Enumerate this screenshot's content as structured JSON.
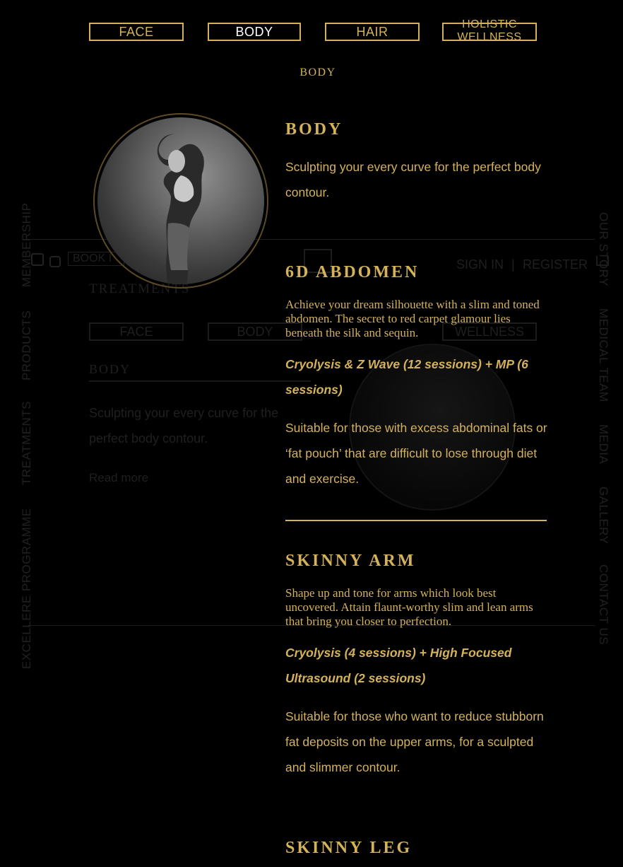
{
  "tabs": [
    {
      "label": "FACE",
      "active": false
    },
    {
      "label": "BODY",
      "active": true
    },
    {
      "label": "HAIR",
      "active": false
    },
    {
      "label": "HOLISTIC WELLNESS",
      "active": false
    }
  ],
  "breadcrumb": "BODY",
  "intro": {
    "title": "BODY",
    "description": "Sculpting your every curve for the perfect body contour."
  },
  "treatments": [
    {
      "title": "6D ABDOMEN",
      "tagline": "Achieve your dream silhouette with a slim and toned abdomen. The secret to red carpet glamour lies beneath the silk and sequin.",
      "package": "Cryolysis & Z Wave (12 sessions) + MP (6 sessions)",
      "suitable": "Suitable for those with excess abdominal fats or ‘fat pouch’ that are difficult to lose through diet and exercise."
    },
    {
      "title": "SKINNY ARM",
      "tagline": "Shape up and tone for arms which look best uncovered. Attain flaunt-worthy slim and lean arms that bring you closer to perfection.",
      "package": "Cryolysis (4 sessions) + High Focused Ultrasound (2 sessions)",
      "suitable": "Suitable for those who want to reduce stubborn fat deposits on the upper arms, for a sculpted and slimmer contour."
    },
    {
      "title": "SKINNY LEG"
    }
  ],
  "background": {
    "left_nav": [
      "MEMBERSHIP",
      "PRODUCTS",
      "TREATMENTS",
      "EXCELLERE PROGRAMME"
    ],
    "right_nav": [
      "OUR STORY",
      "MEDICAL TEAM",
      "MEDIA",
      "GALLERY",
      "CONTACT US"
    ],
    "book_label": "BOOK I",
    "sign_in": "SIGN IN",
    "separator": "|",
    "register": "REGISTER",
    "section_title": "TREATMENTS",
    "tabs": [
      "FACE",
      "BODY",
      "",
      "WELLNESS"
    ],
    "body_title": "BODY",
    "body_desc": "Sculpting your every curve for the perfect body contour.",
    "read_more": "Read more"
  },
  "colors": {
    "gold": "#d4b25c",
    "background": "#000000",
    "active_tab_text": "#ffffff"
  }
}
